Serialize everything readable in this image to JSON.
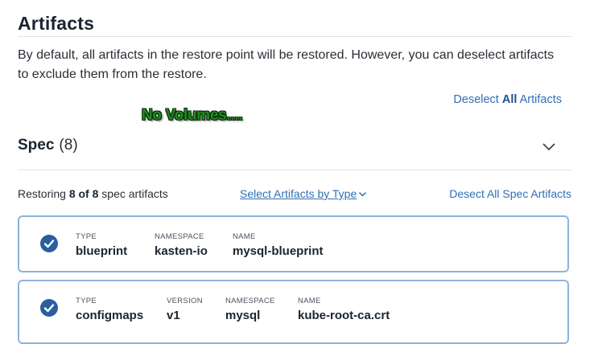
{
  "section": {
    "title": "Artifacts",
    "description": "By default, all artifacts in the restore point will be restored. However, you can deselect artifacts to exclude them from the restore.",
    "deselect_all": {
      "prefix": "Deselect ",
      "bold": "All",
      "suffix": " Artifacts"
    }
  },
  "annotation": {
    "text": "No Volumes...."
  },
  "spec": {
    "title": "Spec",
    "count": "(8)",
    "restoring": {
      "prefix": "Restoring ",
      "bold": "8 of 8",
      "suffix": " spec artifacts"
    },
    "select_by_type": "Select Artifacts by Type",
    "deselect_spec": "Desect All Spec Artifacts"
  },
  "artifacts": [
    {
      "checked": true,
      "fields": [
        {
          "label": "TYPE",
          "value": "blueprint"
        },
        {
          "label": "NAMESPACE",
          "value": "kasten-io"
        },
        {
          "label": "NAME",
          "value": "mysql-blueprint"
        }
      ]
    },
    {
      "checked": true,
      "fields": [
        {
          "label": "TYPE",
          "value": "configmaps"
        },
        {
          "label": "VERSION",
          "value": "v1"
        },
        {
          "label": "NAMESPACE",
          "value": "mysql"
        },
        {
          "label": "NAME",
          "value": "kube-root-ca.crt"
        }
      ]
    }
  ],
  "colors": {
    "link": "#2f6fb5",
    "check": "#2b5ea0",
    "card_border": "#8fb3d9",
    "annotation": "#1f8a1f"
  },
  "icons": {
    "chevron": "chevron-down-icon",
    "check": "check-circle-icon"
  }
}
